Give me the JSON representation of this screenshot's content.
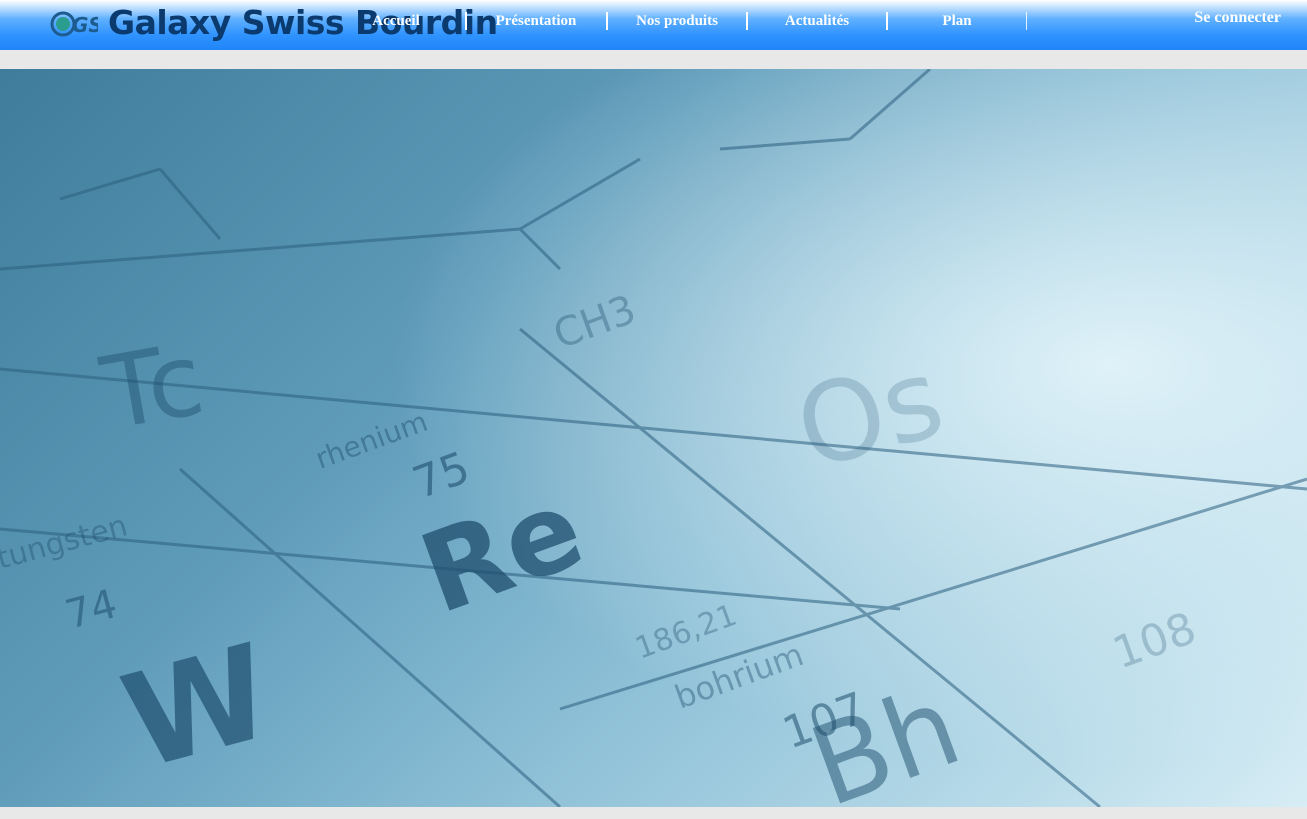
{
  "brand": {
    "name": "Galaxy Swiss Bourdin",
    "logo_mark": "GSB"
  },
  "nav": {
    "items": [
      {
        "id": "accueil",
        "label": "Accueil"
      },
      {
        "id": "presentation",
        "label": "Présentation"
      },
      {
        "id": "produits",
        "label": "Nos produits"
      },
      {
        "id": "actualites",
        "label": "Actualités"
      },
      {
        "id": "plan",
        "label": "Plan"
      }
    ],
    "login": "Se connecter"
  },
  "hero": {
    "description_icon": "periodic-table-hero-image",
    "labels": {
      "re_symbol": "Re",
      "re_number": "75",
      "re_name": "rhenium",
      "re_mass": "186,21",
      "w_symbol": "W",
      "w_number": "74",
      "w_name": "tungsten",
      "os_symbol": "Os",
      "bh_name": "bohrium",
      "bh_number": "107",
      "bh_symbol": "Bh",
      "tc_symbol": "Tc",
      "ch3": "CH3",
      "hs_number": "108"
    }
  },
  "colors": {
    "header_top": "#ffffff",
    "header_bottom": "#1f86f8",
    "brand_text": "#0b3a6e",
    "nav_text": "#ffffff",
    "page_bg": "#e8e8e8"
  }
}
